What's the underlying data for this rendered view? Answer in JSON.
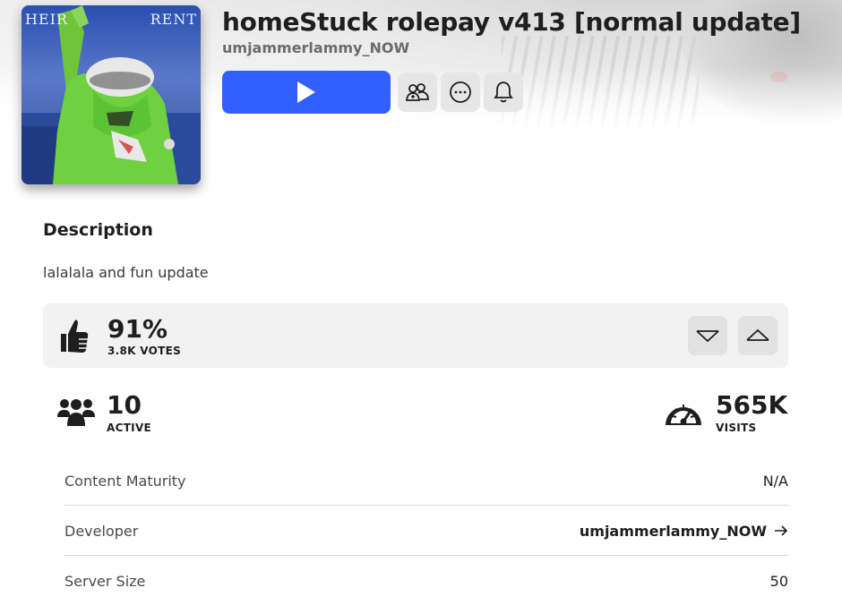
{
  "experience": {
    "title": "homeStuck rolepay v413 [normal update]",
    "creator": "umjammerlammy_NOW",
    "thumbnail_text_left": "HEIR",
    "thumbnail_text_right": "RENT"
  },
  "actions": {
    "play_icon": "play-icon",
    "party_icon": "party-icon",
    "more_icon": "more-options-icon",
    "notify_icon": "bell-icon"
  },
  "description": {
    "heading": "Description",
    "text": "lalalala and fun update"
  },
  "votes": {
    "percent": "91%",
    "count": "3.8K VOTES",
    "downvote_icon": "thumbs-down-icon",
    "upvote_icon": "thumbs-up-icon"
  },
  "stats": {
    "active_value": "10",
    "active_label": "ACTIVE",
    "visits_value": "565K",
    "visits_label": "VISITS"
  },
  "info": [
    {
      "key": "Content Maturity",
      "value": "N/A"
    },
    {
      "key": "Developer",
      "value": "umjammerlammy_NOW"
    },
    {
      "key": "Server Size",
      "value": "50"
    }
  ],
  "colors": {
    "accent": "#335fff",
    "panel": "#f2f2f2"
  }
}
